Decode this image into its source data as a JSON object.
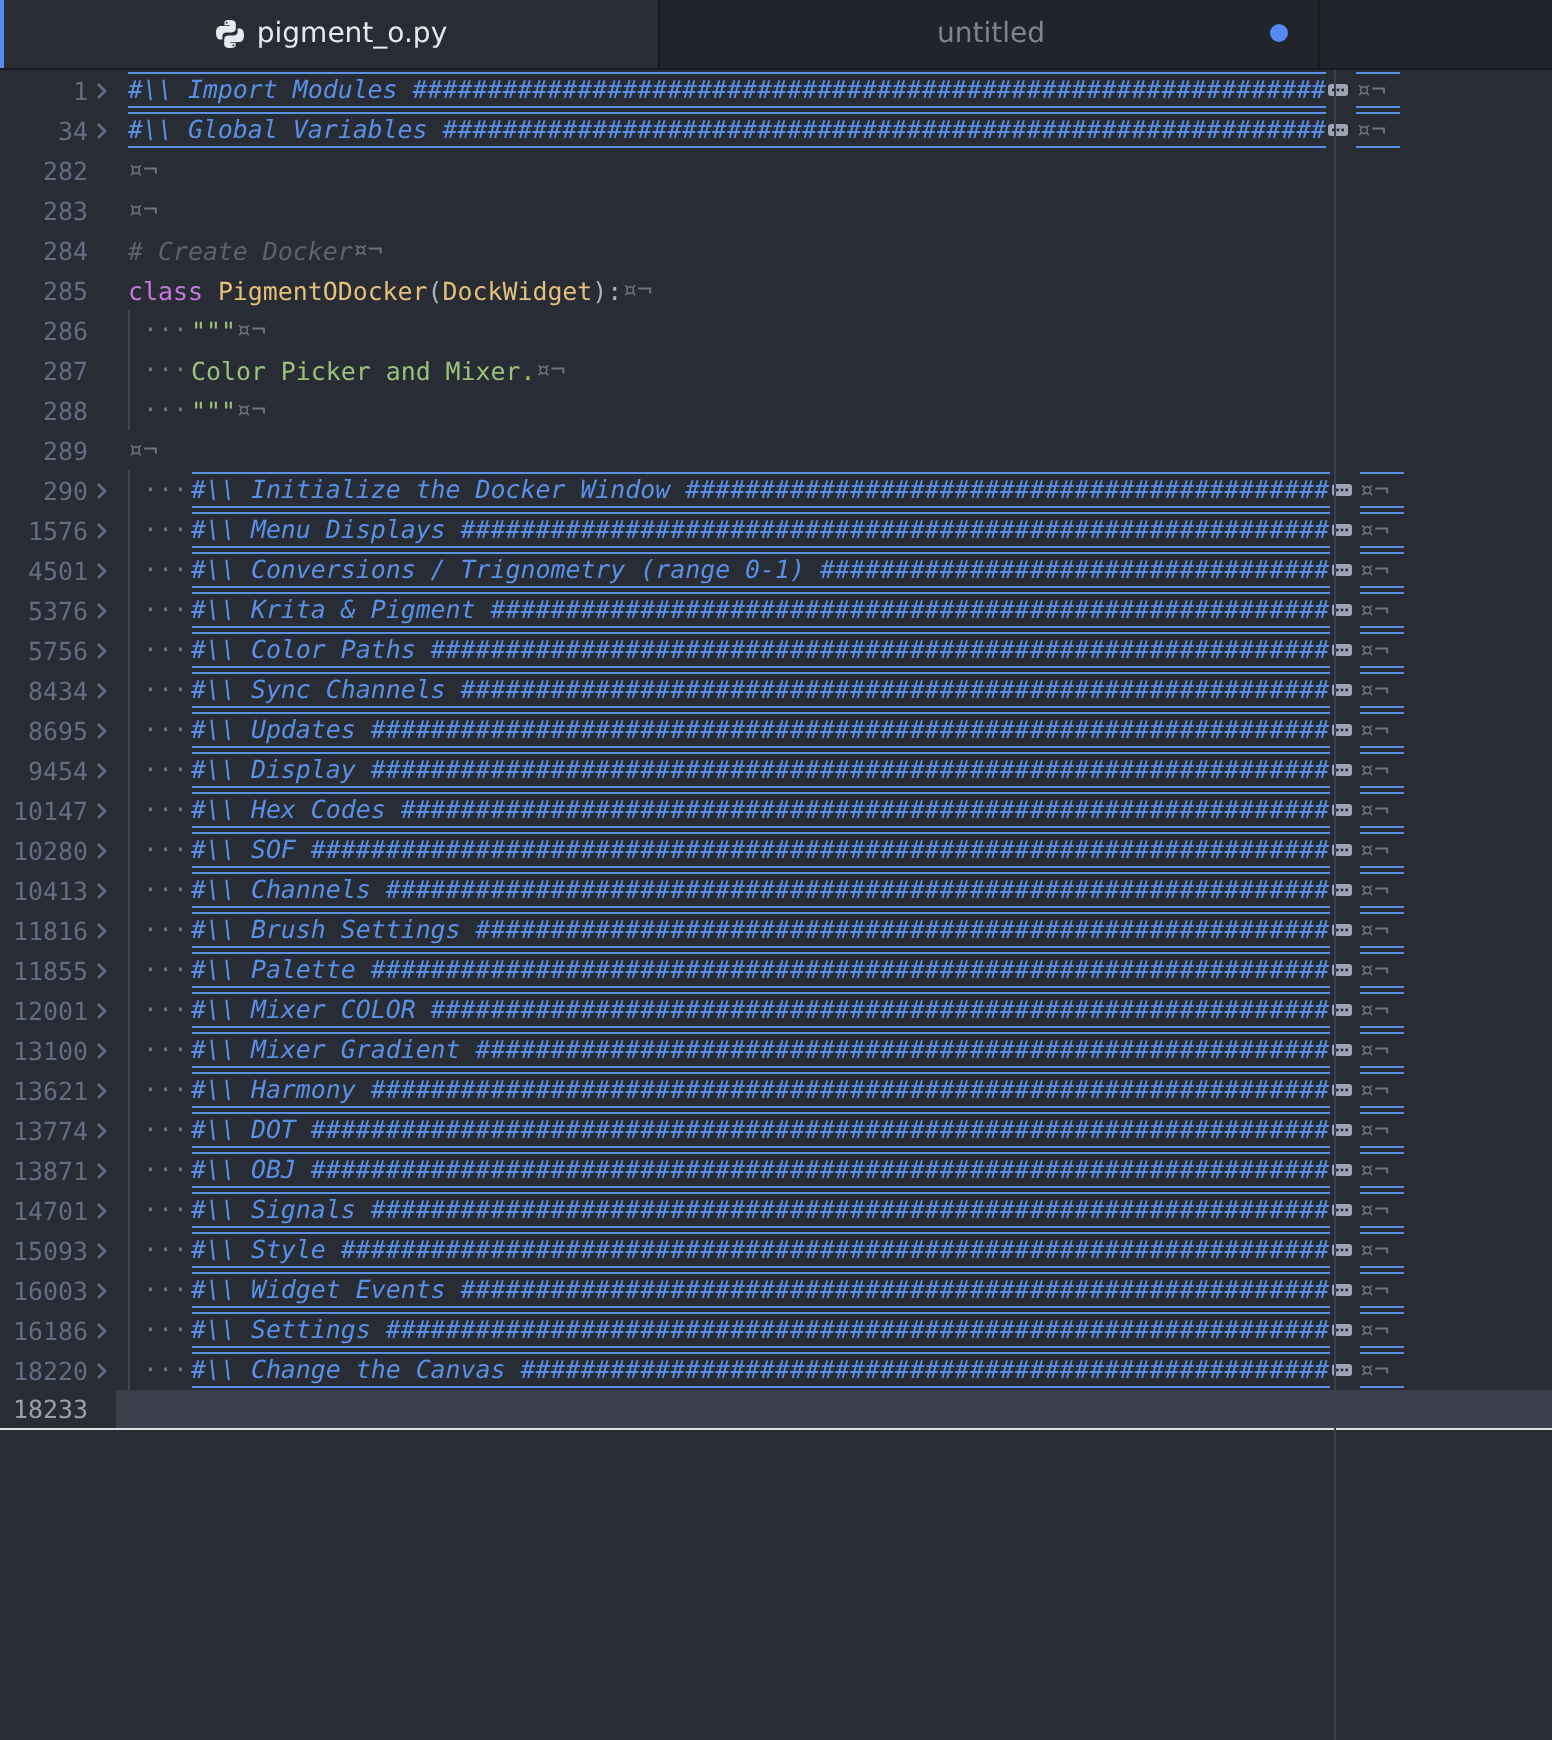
{
  "tabs": [
    {
      "title": "pigment_o.py",
      "selected": true,
      "modified": false
    },
    {
      "title": "untitled",
      "selected": false,
      "modified": true
    }
  ],
  "lines": [
    {
      "number": "1",
      "folded": true,
      "tokens": [
        {
          "kind": "heading",
          "text": "#\\\\ Import Modules #############################################################"
        }
      ],
      "eol": "¤¬"
    },
    {
      "number": "34",
      "folded": true,
      "tokens": [
        {
          "kind": "heading",
          "text": "#\\\\ Global Variables ###########################################################"
        }
      ],
      "eol": "¤¬"
    },
    {
      "number": "282",
      "folded": false,
      "eol": "¤¬"
    },
    {
      "number": "283",
      "folded": false,
      "eol": "¤¬"
    },
    {
      "number": "284",
      "folded": false,
      "tokens": [
        {
          "kind": "comment",
          "text": "# Create Docker"
        }
      ],
      "eol": "¤¬"
    },
    {
      "number": "285",
      "folded": false,
      "tokens": [
        {
          "kind": "keyword",
          "text": "class "
        },
        {
          "kind": "class",
          "text": "PigmentODocker"
        },
        {
          "kind": "punct",
          "text": "("
        },
        {
          "kind": "class",
          "text": "DockWidget"
        },
        {
          "kind": "punct",
          "text": "):"
        }
      ],
      "eol": "¤¬"
    },
    {
      "number": "286",
      "folded": false,
      "leading": "···",
      "tokens": [
        {
          "kind": "string",
          "text": "\"\"\""
        }
      ],
      "eol": "¤¬"
    },
    {
      "number": "287",
      "folded": false,
      "leading": "···",
      "tokens": [
        {
          "kind": "string",
          "text": "Color Picker and Mixer."
        }
      ],
      "eol": "¤¬"
    },
    {
      "number": "288",
      "folded": false,
      "leading": "···",
      "tokens": [
        {
          "kind": "string",
          "text": "\"\"\""
        }
      ],
      "eol": "¤¬"
    },
    {
      "number": "289",
      "folded": false,
      "eol": "¤¬"
    },
    {
      "number": "290",
      "folded": true,
      "leading": "···",
      "tokens": [
        {
          "kind": "heading",
          "text": "#\\\\ Initialize the Docker Window ###########################################"
        }
      ],
      "eol": "¤¬"
    },
    {
      "number": "1576",
      "folded": true,
      "leading": "···",
      "tokens": [
        {
          "kind": "heading",
          "text": "#\\\\ Menu Displays ##########################################################"
        }
      ],
      "eol": "¤¬"
    },
    {
      "number": "4501",
      "folded": true,
      "leading": "···",
      "tokens": [
        {
          "kind": "heading",
          "text": "#\\\\ Conversions / Trignometry (range 0-1) ##################################"
        }
      ],
      "eol": "¤¬"
    },
    {
      "number": "5376",
      "folded": true,
      "leading": "···",
      "tokens": [
        {
          "kind": "heading",
          "text": "#\\\\ Krita & Pigment ########################################################"
        }
      ],
      "eol": "¤¬"
    },
    {
      "number": "5756",
      "folded": true,
      "leading": "···",
      "tokens": [
        {
          "kind": "heading",
          "text": "#\\\\ Color Paths ############################################################"
        }
      ],
      "eol": "¤¬"
    },
    {
      "number": "8434",
      "folded": true,
      "leading": "···",
      "tokens": [
        {
          "kind": "heading",
          "text": "#\\\\ Sync Channels ##########################################################"
        }
      ],
      "eol": "¤¬"
    },
    {
      "number": "8695",
      "folded": true,
      "leading": "···",
      "tokens": [
        {
          "kind": "heading",
          "text": "#\\\\ Updates ################################################################"
        }
      ],
      "eol": "¤¬"
    },
    {
      "number": "9454",
      "folded": true,
      "leading": "···",
      "tokens": [
        {
          "kind": "heading",
          "text": "#\\\\ Display ################################################################"
        }
      ],
      "eol": "¤¬"
    },
    {
      "number": "10147",
      "folded": true,
      "leading": "···",
      "tokens": [
        {
          "kind": "heading",
          "text": "#\\\\ Hex Codes ##############################################################"
        }
      ],
      "eol": "¤¬"
    },
    {
      "number": "10280",
      "folded": true,
      "leading": "···",
      "tokens": [
        {
          "kind": "heading",
          "text": "#\\\\ SOF ####################################################################"
        }
      ],
      "eol": "¤¬"
    },
    {
      "number": "10413",
      "folded": true,
      "leading": "···",
      "tokens": [
        {
          "kind": "heading",
          "text": "#\\\\ Channels ###############################################################"
        }
      ],
      "eol": "¤¬"
    },
    {
      "number": "11816",
      "folded": true,
      "leading": "···",
      "tokens": [
        {
          "kind": "heading",
          "text": "#\\\\ Brush Settings #########################################################"
        }
      ],
      "eol": "¤¬"
    },
    {
      "number": "11855",
      "folded": true,
      "leading": "···",
      "tokens": [
        {
          "kind": "heading",
          "text": "#\\\\ Palette ################################################################"
        }
      ],
      "eol": "¤¬"
    },
    {
      "number": "12001",
      "folded": true,
      "leading": "···",
      "tokens": [
        {
          "kind": "heading",
          "text": "#\\\\ Mixer COLOR ############################################################"
        }
      ],
      "eol": "¤¬"
    },
    {
      "number": "13100",
      "folded": true,
      "leading": "···",
      "tokens": [
        {
          "kind": "heading",
          "text": "#\\\\ Mixer Gradient #########################################################"
        }
      ],
      "eol": "¤¬"
    },
    {
      "number": "13621",
      "folded": true,
      "leading": "···",
      "tokens": [
        {
          "kind": "heading",
          "text": "#\\\\ Harmony ################################################################"
        }
      ],
      "eol": "¤¬"
    },
    {
      "number": "13774",
      "folded": true,
      "leading": "···",
      "tokens": [
        {
          "kind": "heading",
          "text": "#\\\\ DOT ####################################################################"
        }
      ],
      "eol": "¤¬"
    },
    {
      "number": "13871",
      "folded": true,
      "leading": "···",
      "tokens": [
        {
          "kind": "heading",
          "text": "#\\\\ OBJ ####################################################################"
        }
      ],
      "eol": "¤¬"
    },
    {
      "number": "14701",
      "folded": true,
      "leading": "···",
      "tokens": [
        {
          "kind": "heading",
          "text": "#\\\\ Signals ################################################################"
        }
      ],
      "eol": "¤¬"
    },
    {
      "number": "15093",
      "folded": true,
      "leading": "···",
      "tokens": [
        {
          "kind": "heading",
          "text": "#\\\\ Style ##################################################################"
        }
      ],
      "eol": "¤¬"
    },
    {
      "number": "16003",
      "folded": true,
      "leading": "···",
      "tokens": [
        {
          "kind": "heading",
          "text": "#\\\\ Widget Events ##########################################################"
        }
      ],
      "eol": "¤¬"
    },
    {
      "number": "16186",
      "folded": true,
      "leading": "···",
      "tokens": [
        {
          "kind": "heading",
          "text": "#\\\\ Settings ###############################################################"
        }
      ],
      "eol": "¤¬"
    },
    {
      "number": "18220",
      "folded": true,
      "leading": "···",
      "tokens": [
        {
          "kind": "heading",
          "text": "#\\\\ Change the Canvas ######################################################"
        }
      ],
      "eol": "¤¬"
    },
    {
      "number": "18233",
      "folded": false,
      "cursor": true
    }
  ]
}
